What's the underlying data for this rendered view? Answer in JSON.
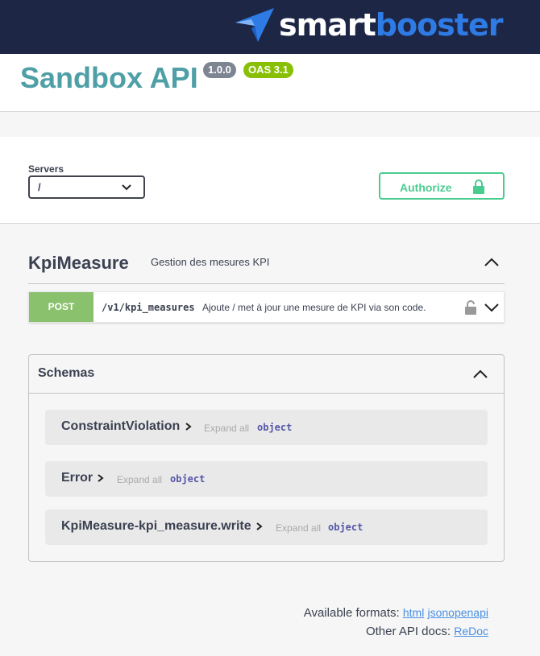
{
  "brand": {
    "name_part1": "smart",
    "name_part2": "booster",
    "colors": {
      "topbar": "#1d2745",
      "accent_blue": "#2f7be6"
    }
  },
  "info": {
    "title": "Sandbox API",
    "version": "1.0.0",
    "oas": "OAS 3.1"
  },
  "servers": {
    "label": "Servers",
    "selected": "/"
  },
  "authorize": {
    "label": "Authorize",
    "icon": "lock-icon"
  },
  "tag": {
    "name": "KpiMeasure",
    "description": "Gestion des mesures KPI"
  },
  "operation": {
    "method": "POST",
    "path": "/v1/kpi_measures",
    "summary": "Ajoute / met à jour une mesure de KPI via son code.",
    "color": "#8ac16d"
  },
  "schemas": {
    "title": "Schemas",
    "models": [
      {
        "name": "ConstraintViolation",
        "expand_label": "Expand all",
        "type": "object"
      },
      {
        "name": "Error",
        "expand_label": "Expand all",
        "type": "object"
      },
      {
        "name": "KpiMeasure-kpi_measure.write",
        "expand_label": "Expand all",
        "type": "object"
      }
    ]
  },
  "footer": {
    "formats_label": "Available formats:",
    "format_html": "html",
    "format_json": "jsonopenapi",
    "docs_label": "Other API docs:",
    "docs_redoc": "ReDoc"
  }
}
